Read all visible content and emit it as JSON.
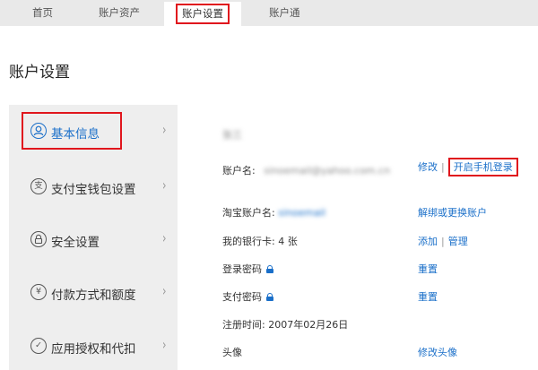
{
  "topnav": {
    "items": [
      {
        "label": "首页"
      },
      {
        "label": "账户资产"
      },
      {
        "label": "账户设置"
      },
      {
        "label": "账户通"
      }
    ]
  },
  "page_title": "账户设置",
  "sidebar": {
    "items": [
      {
        "label": "基本信息",
        "icon": "user-icon",
        "glyph": ""
      },
      {
        "label": "支付宝钱包设置",
        "icon": "wallet-icon",
        "glyph": "支"
      },
      {
        "label": "安全设置",
        "icon": "lock-icon",
        "glyph": ""
      },
      {
        "label": "付款方式和额度",
        "icon": "yuan-icon",
        "glyph": "¥"
      },
      {
        "label": "应用授权和代扣",
        "icon": "check-icon",
        "glyph": "✓"
      }
    ],
    "chevron": "›"
  },
  "content": {
    "name_value": "张三",
    "account_label": "账户名:",
    "account_value": "sinoemail@yahoo.com.cn",
    "account_edit": "修改",
    "account_sep": "|",
    "mobile_login": "开启手机登录",
    "taobao_label": "淘宝账户名:",
    "taobao_value": "sinoemail",
    "taobao_action": "解绑或更换账户",
    "bankcard_text": "我的银行卡: 4 张",
    "bankcard_add": "添加",
    "bankcard_sep": "|",
    "bankcard_manage": "管理",
    "login_pwd_label": "登录密码",
    "login_pwd_action": "重置",
    "pay_pwd_label": "支付密码",
    "pay_pwd_action": "重置",
    "register_text": "注册时间:  2007年02月26日",
    "avatar_label": "头像",
    "avatar_action": "修改头像"
  },
  "colors": {
    "link": "#1a6fc9",
    "highlight": "#e0161d",
    "sidebar_bg": "#eeeeee",
    "nav_bg": "#e9e9e9"
  }
}
